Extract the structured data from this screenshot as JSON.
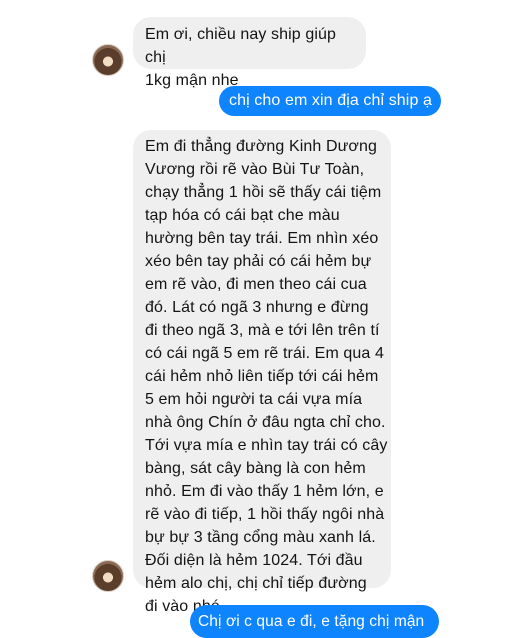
{
  "conversation": {
    "messages": [
      {
        "sender": "contact",
        "text": "Em ơi, chiều nay ship giúp chị\n1kg mận nhe"
      },
      {
        "sender": "me",
        "text": "chị cho em xin địa chỉ ship ạ"
      },
      {
        "sender": "contact",
        "text": "Em đi thẳng đường Kinh Dương\nVương rồi rẽ vào Bùi Tư Toàn,\nchạy thẳng 1 hồi sẽ thấy cái tiệm\ntạp hóa có cái bạt che màu\nhường bên tay trái. Em nhìn xéo\nxéo bên tay phải có cái hẻm bự\nem rẽ vào, đi men theo cái cua\nđó. Lát có ngã 3 nhưng e đừng\nđi theo ngã 3, mà e tới lên trên tí\ncó cái ngã 5 em rẽ trái. Em qua 4\ncái hẻm nhỏ liên tiếp tới cái hẻm\n5 em hỏi người ta cái vựa mía\nnhà ông Chín ở đâu ngta chỉ cho.\nTới vựa mía e nhìn tay trái có cây\nbàng, sát cây bàng là con hẻm\nnhỏ. Em đi vào thấy 1 hẻm lớn, e\nrẽ vào đi tiếp, 1 hồi thấy ngôi nhà\nbự bự 3 tầng cổng màu xanh lá.\nĐối diện là hẻm 1024. Tới đầu\nhẻm alo chị, chị chỉ tiếp đường\nđi vào nhé"
      },
      {
        "sender": "me",
        "text": "Chị ơi c qua e đi, e tặng chị mận"
      }
    ]
  },
  "colors": {
    "outgoing_bubble": "#0f84ff",
    "incoming_bubble": "#efefef"
  }
}
